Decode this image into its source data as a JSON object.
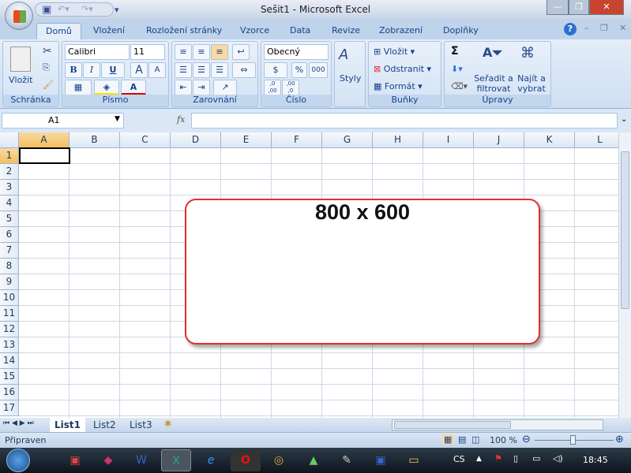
{
  "window": {
    "title": "Sešit1 - Microsoft Excel",
    "minimize": "—",
    "restore": "❐",
    "close": "✕"
  },
  "tabs": [
    "Domů",
    "Vložení",
    "Rozložení stránky",
    "Vzorce",
    "Data",
    "Revize",
    "Zobrazení",
    "Doplňky"
  ],
  "ribbon": {
    "clipboard": {
      "label": "Schránka",
      "paste": "Vložit"
    },
    "font": {
      "label": "Písmo",
      "name": "Calibri",
      "size": "11",
      "bold": "B",
      "italic": "I",
      "underline": "U",
      "grow": "A",
      "shrink": "A",
      "fontcolor": "A"
    },
    "alignment": {
      "label": "Zarovnání"
    },
    "number": {
      "label": "Číslo",
      "format": "Obecný",
      "percent": "%",
      "thousands": "000",
      "inc": ",0 ,00",
      "dec": ",00 ,0"
    },
    "styles": {
      "label": "Styly"
    },
    "cells": {
      "label": "Buňky",
      "insert": "Vložit",
      "delete": "Odstranit",
      "format": "Formát"
    },
    "editing": {
      "label": "Úpravy",
      "sum": "Σ",
      "sort": "Seřadit a filtrovat",
      "find": "Najít a vybrat"
    }
  },
  "formula_bar": {
    "name_box": "A1",
    "fx": "fx",
    "value": ""
  },
  "columns": [
    "A",
    "B",
    "C",
    "D",
    "E",
    "F",
    "G",
    "H",
    "I",
    "J",
    "K",
    "L"
  ],
  "rows": [
    "1",
    "2",
    "3",
    "4",
    "5",
    "6",
    "7",
    "8",
    "9",
    "10",
    "11",
    "12",
    "13",
    "14",
    "15",
    "16",
    "17"
  ],
  "callout": "800 x 600",
  "sheets": [
    "List1",
    "List2",
    "List3"
  ],
  "active_sheet": "List1",
  "status": {
    "text": "Připraven",
    "zoom": "100 %",
    "zoom_level": 100
  },
  "taskbar": {
    "lang": "CS",
    "time": "18:45"
  }
}
